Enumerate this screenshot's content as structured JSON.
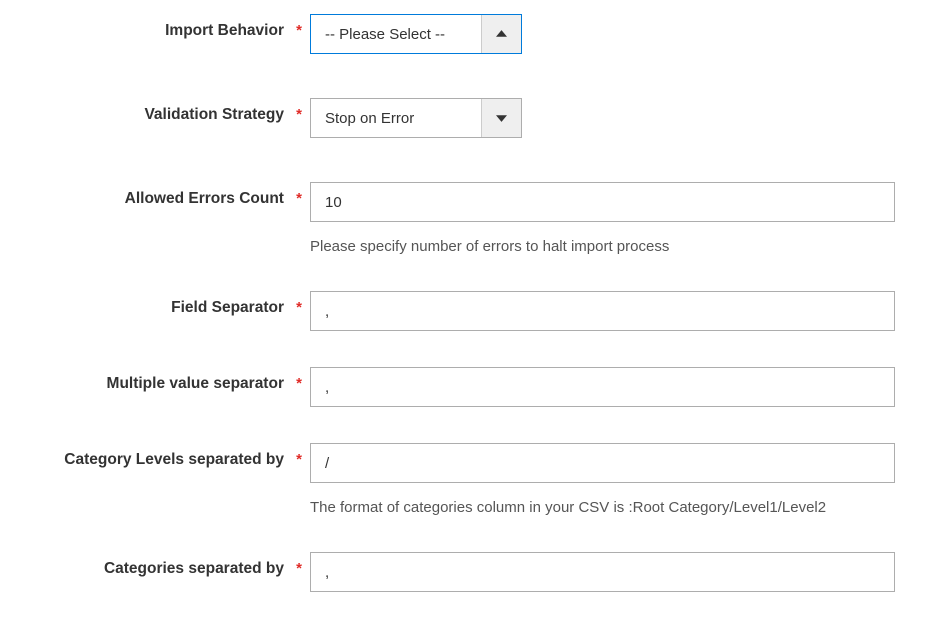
{
  "fields": {
    "import_behavior": {
      "label": "Import Behavior",
      "value": "-- Please Select --"
    },
    "validation_strategy": {
      "label": "Validation Strategy",
      "value": "Stop on Error"
    },
    "allowed_errors": {
      "label": "Allowed Errors Count",
      "value": "10",
      "hint": "Please specify number of errors to halt import process"
    },
    "field_sep": {
      "label": "Field Separator",
      "value": ","
    },
    "multi_sep": {
      "label": "Multiple value separator",
      "value": ","
    },
    "cat_levels": {
      "label": "Category Levels separated by",
      "value": "/",
      "hint": "The format of categories column in your CSV is :Root Category/Level1/Level2"
    },
    "cat_sep": {
      "label": "Categories separated by",
      "value": ","
    }
  }
}
